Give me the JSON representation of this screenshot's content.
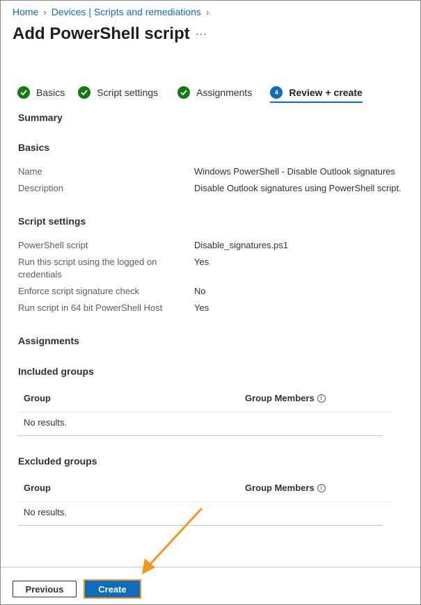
{
  "breadcrumb": {
    "home": "Home",
    "devices": "Devices | Scripts and remediations"
  },
  "header": {
    "title": "Add PowerShell script",
    "more": "···"
  },
  "steps": [
    {
      "label": "Basics",
      "status": "complete"
    },
    {
      "label": "Script settings",
      "status": "complete"
    },
    {
      "label": "Assignments",
      "status": "complete"
    },
    {
      "label": "Review + create",
      "number": "4",
      "status": "active"
    }
  ],
  "summary": {
    "heading": "Summary",
    "basics": {
      "heading": "Basics",
      "name_label": "Name",
      "name_value": "Windows PowerShell - Disable Outlook signatures",
      "description_label": "Description",
      "description_value": "Disable Outlook signatures using PowerShell script."
    },
    "script_settings": {
      "heading": "Script settings",
      "script_label": "PowerShell script",
      "script_value": "Disable_signatures.ps1",
      "logged_on_label": "Run this script using the logged on credentials",
      "logged_on_value": "Yes",
      "signature_label": "Enforce script signature check",
      "signature_value": "No",
      "host64_label": "Run script in 64 bit PowerShell Host",
      "host64_value": "Yes"
    },
    "assignments": {
      "heading": "Assignments",
      "included": {
        "heading": "Included groups",
        "col_group": "Group",
        "col_members": "Group Members",
        "empty": "No results."
      },
      "excluded": {
        "heading": "Excluded groups",
        "col_group": "Group",
        "col_members": "Group Members",
        "empty": "No results."
      }
    }
  },
  "footer": {
    "previous": "Previous",
    "create": "Create"
  },
  "colors": {
    "accent": "#0f6cbd",
    "success": "#107c10",
    "highlight": "#f7941d"
  }
}
